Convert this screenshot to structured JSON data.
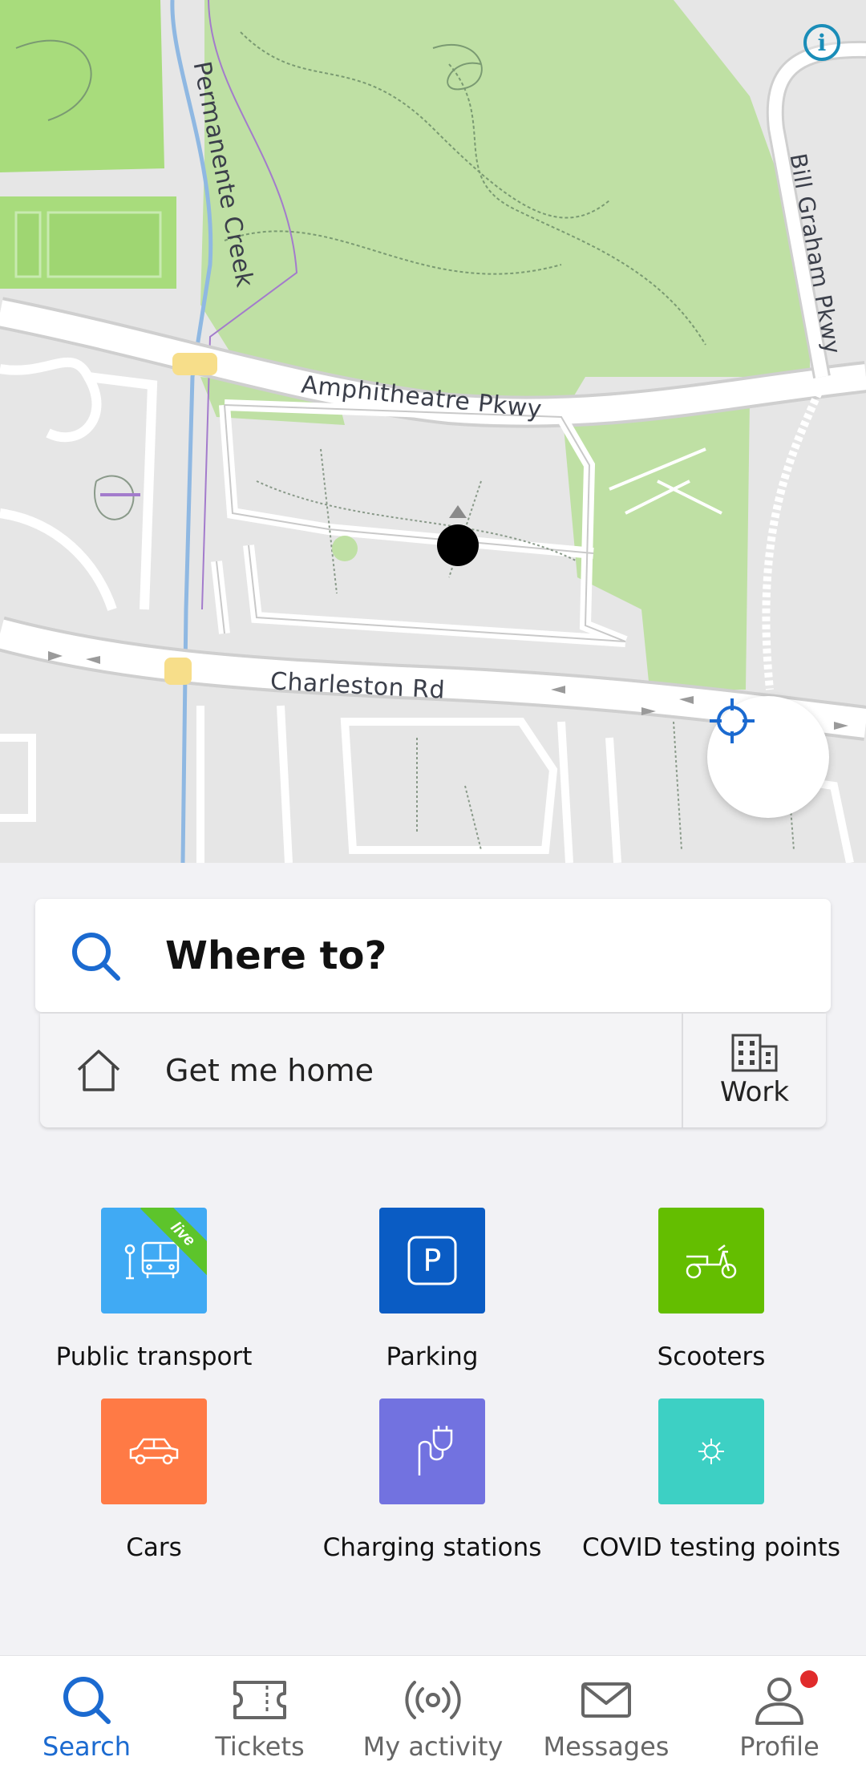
{
  "map": {
    "labels": {
      "creek": "Permanente Creek",
      "amphitheatre": "Amphitheatre Pkwy",
      "bill_graham": "Bill Graham Pkwy",
      "charleston": "Charleston Rd"
    },
    "info_icon": "info-icon",
    "locate_icon": "crosshair-icon"
  },
  "search": {
    "placeholder": "Where to?",
    "icon": "search-icon"
  },
  "shortcuts": {
    "home_label": "Get me home",
    "home_icon": "house-icon",
    "work_label": "Work",
    "work_icon": "building-icon"
  },
  "categories": [
    {
      "label": "Public transport",
      "color": "#40aaf4",
      "icon": "bus-stop-icon",
      "badge": "live"
    },
    {
      "label": "Parking",
      "color": "#0a5cc4",
      "icon": "parking-icon"
    },
    {
      "label": "Scooters",
      "color": "#64be00",
      "icon": "scooter-icon"
    },
    {
      "label": "Cars",
      "color": "#ff7a45",
      "icon": "car-icon"
    },
    {
      "label": "Charging stations",
      "color": "#7272e0",
      "icon": "plug-icon"
    },
    {
      "label": "COVID testing points",
      "color": "#3dd0c4",
      "icon": "virus-icon"
    }
  ],
  "nav": {
    "items": [
      {
        "label": "Search",
        "icon": "search-icon",
        "active": true
      },
      {
        "label": "Tickets",
        "icon": "ticket-icon"
      },
      {
        "label": "My activity",
        "icon": "broadcast-icon"
      },
      {
        "label": "Messages",
        "icon": "envelope-icon"
      },
      {
        "label": "Profile",
        "icon": "person-icon",
        "notification": true
      }
    ]
  },
  "colors": {
    "accent": "#1b6ad0",
    "park_green": "#bfe0a4",
    "bright_green": "#a8dc7c",
    "notification_red": "#e02b2b"
  }
}
